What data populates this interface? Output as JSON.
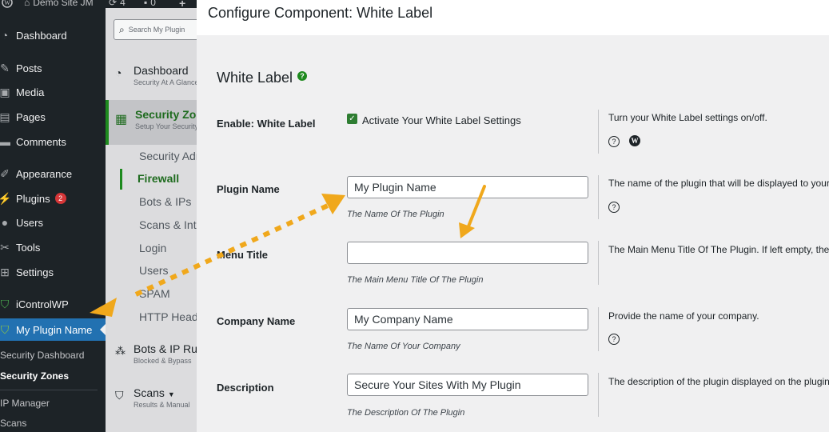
{
  "admin_bar": {
    "site_name": "Demo Site JM",
    "updates_count": "4",
    "comments_count": "0",
    "new_label": "+"
  },
  "wp_menu": {
    "items": [
      {
        "label": "Dashboard",
        "icon": "dashboard-icon"
      },
      {
        "label": "Posts",
        "icon": "pin-icon"
      },
      {
        "label": "Media",
        "icon": "media-icon"
      },
      {
        "label": "Pages",
        "icon": "pages-icon"
      },
      {
        "label": "Comments",
        "icon": "comment-icon"
      },
      {
        "label": "Appearance",
        "icon": "brush-icon"
      },
      {
        "label": "Plugins",
        "icon": "plugin-icon",
        "badge": "2"
      },
      {
        "label": "Users",
        "icon": "users-icon"
      },
      {
        "label": "Tools",
        "icon": "wrench-icon"
      },
      {
        "label": "Settings",
        "icon": "settings-icon"
      },
      {
        "label": "iControlWP",
        "icon": "shield-icon"
      },
      {
        "label": "My Plugin Name",
        "icon": "shield-icon"
      }
    ],
    "submenu": [
      "Security Dashboard",
      "Security Zones",
      "IP Manager",
      "Scans"
    ]
  },
  "plugin_menu": {
    "search_placeholder": "Search My Plugin",
    "dashboard": {
      "title": "Dashboard",
      "subtitle": "Security At A Glance"
    },
    "security_zones": {
      "title": "Security Zones",
      "subtitle": "Setup Your Security Zones"
    },
    "zone_items": [
      "Security Admin",
      "Firewall",
      "Bots & IPs",
      "Scans & Integrity",
      "Login",
      "Users",
      "SPAM",
      "HTTP Headers"
    ],
    "bots_rules": {
      "title": "Bots & IP Rules",
      "subtitle": "Blocked & Bypass"
    },
    "scans": {
      "title": "Scans",
      "subtitle": "Results & Manual"
    }
  },
  "modal": {
    "title": "Configure Component: White Label",
    "section_title": "White Label",
    "help_glyph": "?",
    "fields": [
      {
        "label": "Enable: White Label",
        "checkbox_label": "Activate Your White Label Settings",
        "description": "Turn your White Label settings on/off."
      },
      {
        "label": "Plugin Name",
        "value": "My Plugin Name",
        "hint": "The Name Of The Plugin",
        "description": "The name of the plugin that will be displayed to your"
      },
      {
        "label": "Menu Title",
        "value": "",
        "hint": "The Main Menu Title Of The Plugin",
        "description": "The Main Menu Title Of The Plugin. If left empty, the"
      },
      {
        "label": "Company Name",
        "value": "My Company Name",
        "hint": "The Name Of Your Company",
        "description": "Provide the name of your company."
      },
      {
        "label": "Description",
        "value": "Secure Your Sites With My Plugin",
        "hint": "The Description Of The Plugin",
        "description": "The description of the plugin displayed on the plugin"
      }
    ]
  },
  "colors": {
    "admin_dark": "#1d2327",
    "accent_blue": "#2271b1",
    "arrow_orange": "#f0a81c",
    "check_green": "#2e7d32"
  }
}
